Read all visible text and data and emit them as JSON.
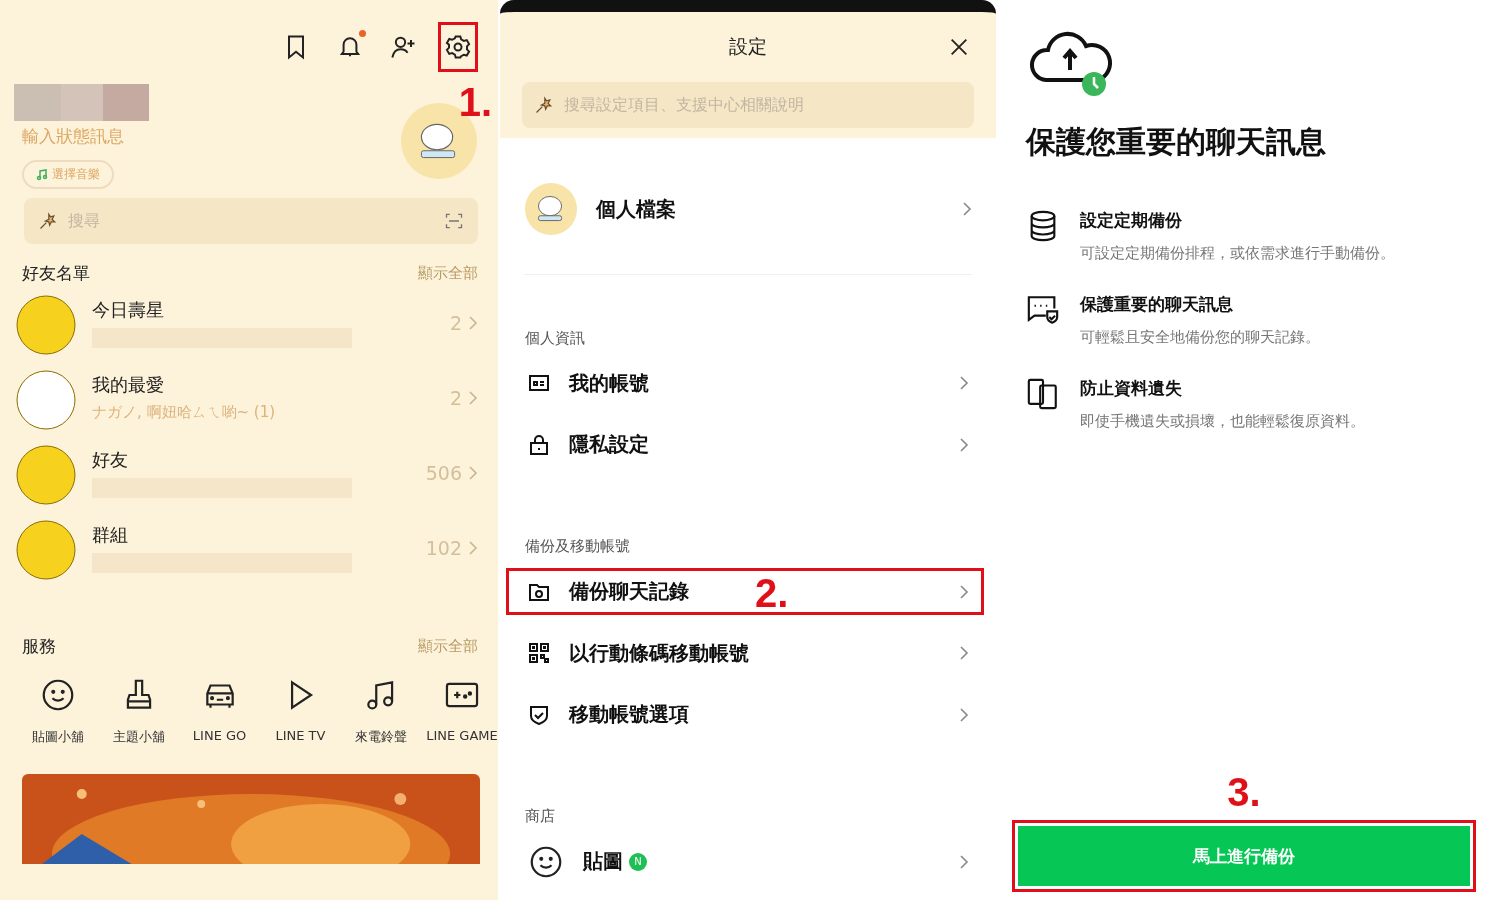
{
  "home": {
    "toolbar": [
      {
        "kind": "bookmark",
        "highlighted": false
      },
      {
        "kind": "bell",
        "notification": true,
        "highlighted": false
      },
      {
        "kind": "add-friend",
        "highlighted": false
      },
      {
        "kind": "settings",
        "highlighted": true
      }
    ],
    "annotation": "1.",
    "status_placeholder": "輸入狀態訊息",
    "music_button": "選擇音樂",
    "search": {
      "placeholder": "搜尋"
    },
    "friends": {
      "title": "好友名單",
      "show_all": "顯示全部",
      "items": [
        {
          "name": "今日壽星",
          "count": "2",
          "color": "#f6d21e"
        },
        {
          "name": "我的最愛",
          "subtitle": "ナガノ, 啊妞哈ㄙㄟ喲~ (1)",
          "count": "2",
          "color": "#ffffff"
        },
        {
          "name": "好友",
          "count": "506",
          "color": "#f6d21e"
        },
        {
          "name": "群組",
          "count": "102",
          "color": "#f6d21e"
        }
      ]
    },
    "services": {
      "title": "服務",
      "show_all": "顯示全部",
      "items": [
        {
          "kind": "smile",
          "label": "貼圖小舖"
        },
        {
          "kind": "brush",
          "label": "主題小舖"
        },
        {
          "kind": "car",
          "label": "LINE GO"
        },
        {
          "kind": "play",
          "label": "LINE TV"
        },
        {
          "kind": "note",
          "label": "來電鈴聲"
        },
        {
          "kind": "game",
          "label": "LINE GAME"
        }
      ]
    }
  },
  "settings": {
    "title": "設定",
    "search": {
      "placeholder": "搜尋設定項目、支援中心相關說明"
    },
    "profile": "個人檔案",
    "sections": [
      {
        "title": "個人資訊",
        "items": [
          {
            "kind": "card",
            "label": "我的帳號",
            "highlighted": false
          },
          {
            "kind": "lock",
            "label": "隱私設定",
            "highlighted": false
          }
        ]
      },
      {
        "title": "備份及移動帳號",
        "items": [
          {
            "kind": "folder",
            "label": "備份聊天記錄",
            "highlighted": true,
            "annotation": "2."
          },
          {
            "kind": "qr",
            "label": "以行動條碼移動帳號",
            "highlighted": false
          },
          {
            "kind": "shield",
            "label": "移動帳號選項",
            "highlighted": false
          }
        ]
      },
      {
        "title": "商店",
        "items": [
          {
            "kind": "smile",
            "label": "貼圖",
            "highlighted": false,
            "badge": "N"
          }
        ]
      }
    ]
  },
  "backup": {
    "title": "保護您重要的聊天訊息",
    "features": [
      {
        "kind": "database",
        "title": "設定定期備份",
        "description": "可設定定期備份排程，或依需求進行手動備份。"
      },
      {
        "kind": "chat-shield",
        "title": "保護重要的聊天訊息",
        "description": "可輕鬆且安全地備份您的聊天記錄。"
      },
      {
        "kind": "phones",
        "title": "防止資料遺失",
        "description": "即使手機遺失或損壞，也能輕鬆復原資料。"
      }
    ],
    "annotation": "3.",
    "button": "馬上進行備份",
    "button_highlighted": true
  }
}
